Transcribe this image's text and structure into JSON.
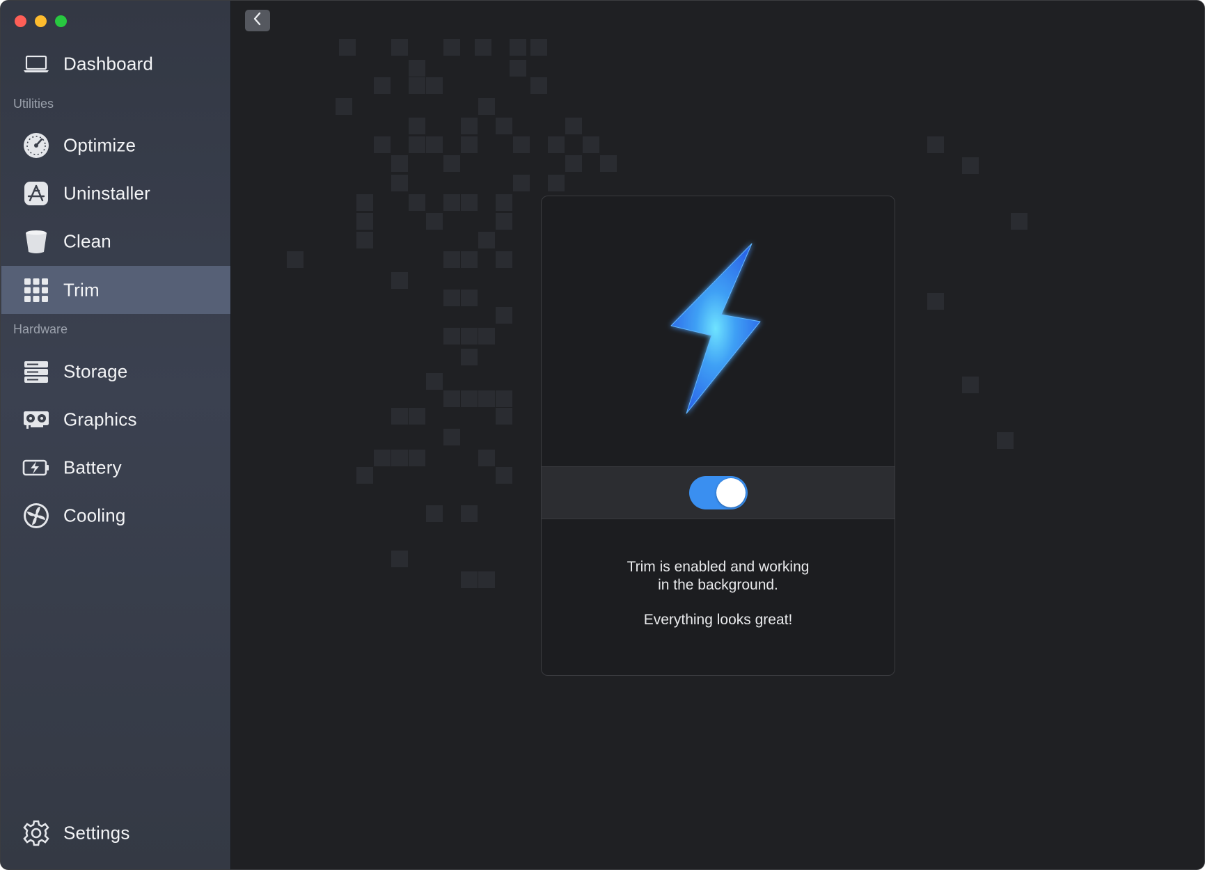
{
  "window": {
    "traffic_lights": [
      "close",
      "minimize",
      "zoom"
    ]
  },
  "sidebar": {
    "top_item": {
      "label": "Dashboard",
      "icon": "laptop-icon"
    },
    "sections": [
      {
        "title": "Utilities",
        "items": [
          {
            "label": "Optimize",
            "icon": "speedometer-icon"
          },
          {
            "label": "Uninstaller",
            "icon": "app-store-icon"
          },
          {
            "label": "Clean",
            "icon": "trash-bin-icon"
          },
          {
            "label": "Trim",
            "icon": "grid-icon",
            "active": true
          }
        ]
      },
      {
        "title": "Hardware",
        "items": [
          {
            "label": "Storage",
            "icon": "server-icon"
          },
          {
            "label": "Graphics",
            "icon": "graphics-card-icon"
          },
          {
            "label": "Battery",
            "icon": "battery-bolt-icon"
          },
          {
            "label": "Cooling",
            "icon": "fan-icon"
          }
        ]
      }
    ],
    "bottom_item": {
      "label": "Settings",
      "icon": "gear-icon"
    }
  },
  "main": {
    "back_button_icon": "chevron-left-icon",
    "card": {
      "illustration_icon": "lightning-bolt-icon",
      "toggle_on": true,
      "status_line_1": "Trim is enabled and working",
      "status_line_2": "in the background.",
      "status_line_3": "Everything looks great!"
    }
  },
  "colors": {
    "accent": "#3a8ff0",
    "sidebar_active": "#566076",
    "main_bg": "#1f2023"
  }
}
